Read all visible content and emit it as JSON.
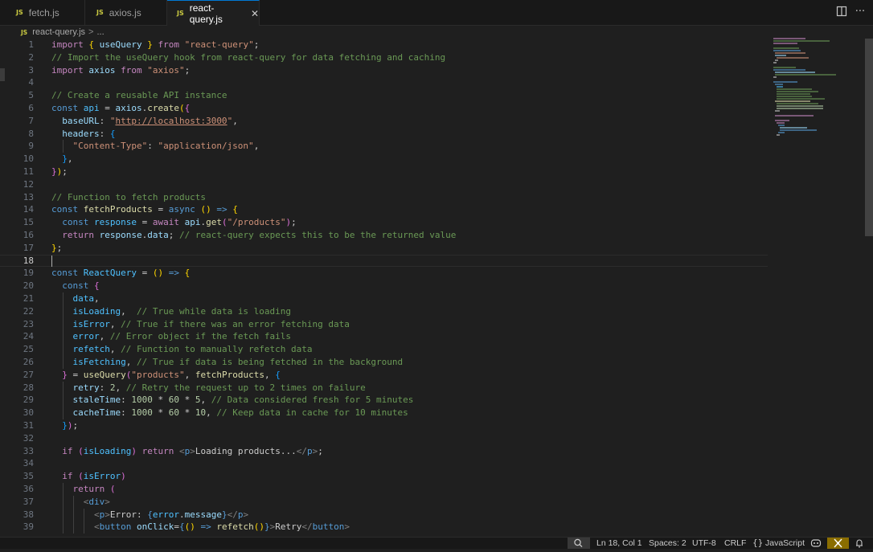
{
  "tabs": [
    {
      "icon": "JS",
      "label": "fetch.js",
      "active": false
    },
    {
      "icon": "JS",
      "label": "axios.js",
      "active": false
    },
    {
      "icon": "JS",
      "label": "react-query.js",
      "active": true,
      "close": "✕"
    }
  ],
  "breadcrumb": {
    "icon": "JS",
    "file": "react-query.js",
    "separator": ">",
    "more": "..."
  },
  "line_numbers": [
    "1",
    "2",
    "3",
    "4",
    "5",
    "6",
    "7",
    "8",
    "9",
    "10",
    "11",
    "12",
    "13",
    "14",
    "15",
    "16",
    "17",
    "18",
    "19",
    "20",
    "21",
    "22",
    "23",
    "24",
    "25",
    "26",
    "27",
    "28",
    "29",
    "30",
    "31",
    "32",
    "33",
    "34",
    "35",
    "36",
    "37",
    "38",
    "39"
  ],
  "code": {
    "l1": {
      "kw": "import",
      "b": "{",
      "name": "useQuery",
      "b2": "}",
      "from": "from",
      "str": "\"react-query\"",
      "end": ";"
    },
    "l2": {
      "comment": "// Import the useQuery hook from react-query for data fetching and caching"
    },
    "l3": {
      "kw": "import",
      "name": "axios",
      "from": "from",
      "str": "\"axios\"",
      "end": ";"
    },
    "l5": {
      "comment": "// Create a reusable API instance"
    },
    "l6": {
      "kw": "const",
      "name": "api",
      "eq": "=",
      "obj": "axios",
      "dot": ".",
      "fn": "create",
      "p": "(",
      "b": "{"
    },
    "l7": {
      "key": "baseURL",
      "colon": ":",
      "q1": "\"",
      "url": "http://localhost:3000",
      "q2": "\"",
      "comma": ","
    },
    "l8": {
      "key": "headers",
      "colon": ":",
      "b": "{"
    },
    "l9": {
      "key": "\"Content-Type\"",
      "colon": ":",
      "val": "\"application/json\"",
      "comma": ","
    },
    "l10": {
      "b": "}",
      "comma": ","
    },
    "l11": {
      "b": "}",
      "p": ")",
      "end": ";"
    },
    "l13": {
      "comment": "// Function to fetch products"
    },
    "l14": {
      "kw": "const",
      "name": "fetchProducts",
      "eq": "=",
      "async": "async",
      "p": "()",
      "arrow": "=>",
      "b": "{"
    },
    "l15": {
      "kw": "const",
      "name": "response",
      "eq": "=",
      "await": "await",
      "obj": "api",
      "dot": ".",
      "fn": "get",
      "p1": "(",
      "str": "\"/products\"",
      "p2": ")",
      "end": ";"
    },
    "l16": {
      "kw": "return",
      "obj": "response",
      "dot": ".",
      "prop": "data",
      "end": ";",
      "comment": "// react-query expects this to be the returned value"
    },
    "l17": {
      "b": "}",
      "end": ";"
    },
    "l19": {
      "kw": "const",
      "name": "ReactQuery",
      "eq": "=",
      "p": "()",
      "arrow": "=>",
      "b": "{"
    },
    "l20": {
      "kw": "const",
      "b": "{"
    },
    "l21": {
      "name": "data",
      "comma": ","
    },
    "l22": {
      "name": "isLoading",
      "comma": ",",
      "comment": "// True while data is loading"
    },
    "l23": {
      "name": "isError",
      "comma": ",",
      "comment": "// True if there was an error fetching data"
    },
    "l24": {
      "name": "error",
      "comma": ",",
      "comment": "// Error object if the fetch fails"
    },
    "l25": {
      "name": "refetch",
      "comma": ",",
      "comment": "// Function to manually refetch data"
    },
    "l26": {
      "name": "isFetching",
      "comma": ",",
      "comment": "// True if data is being fetched in the background"
    },
    "l27": {
      "b": "}",
      "eq": "=",
      "fn": "useQuery",
      "p": "(",
      "str": "\"products\"",
      "comma": ",",
      "arg": "fetchProducts",
      "comma2": ",",
      "b2": "{"
    },
    "l28": {
      "key": "retry",
      "colon": ":",
      "num": "2",
      "comma": ",",
      "comment": "// Retry the request up to 2 times on failure"
    },
    "l29": {
      "key": "staleTime",
      "colon": ":",
      "n1": "1000",
      "op1": "*",
      "n2": "60",
      "op2": "*",
      "n3": "5",
      "comma": ",",
      "comment": "// Data considered fresh for 5 minutes"
    },
    "l30": {
      "key": "cacheTime",
      "colon": ":",
      "n1": "1000",
      "op1": "*",
      "n2": "60",
      "op2": "*",
      "n3": "10",
      "comma": ",",
      "comment": "// Keep data in cache for 10 minutes"
    },
    "l31": {
      "b": "}",
      "p": ")",
      "end": ";"
    },
    "l33": {
      "kw": "if",
      "p1": "(",
      "name": "isLoading",
      "p2": ")",
      "ret": "return",
      "open": "<",
      "tag": "p",
      "gt": ">",
      "text": "Loading products...",
      "close": "</",
      "tag2": "p",
      "gt2": ">",
      "end": ";"
    },
    "l35": {
      "kw": "if",
      "p1": "(",
      "name": "isError",
      "p2": ")"
    },
    "l36": {
      "ret": "return",
      "p": "("
    },
    "l37": {
      "open": "<",
      "tag": "div",
      "gt": ">"
    },
    "l38": {
      "open": "<",
      "tag": "p",
      "gt": ">",
      "text": "Error: ",
      "b": "{",
      "obj": "error",
      "dot": ".",
      "prop": "message",
      "b2": "}",
      "close": "</",
      "tag2": "p",
      "gt2": ">"
    },
    "l39": {
      "open": "<",
      "tag": "button",
      "attr": "onClick",
      "eq": "=",
      "b": "{",
      "p": "()",
      "arrow": "=>",
      "fn": "refetch",
      "p2": "()",
      "b2": "}",
      "gt": ">",
      "text": "Retry",
      "close": "</",
      "tag2": "button",
      "gt2": ">"
    }
  },
  "status": {
    "zoom_icon": "zoom-icon",
    "position": "Ln 18, Col 1",
    "spaces": "Spaces: 2",
    "encoding": "UTF-8",
    "eol": "CRLF",
    "braces": "{}",
    "language": "JavaScript"
  },
  "colors": {
    "keyword": "#569cd6",
    "control": "#c586c0",
    "string": "#ce9178",
    "comment": "#6a9955",
    "function": "#dcdcaa",
    "variable": "#9cdcfe",
    "number": "#b5cea8"
  }
}
